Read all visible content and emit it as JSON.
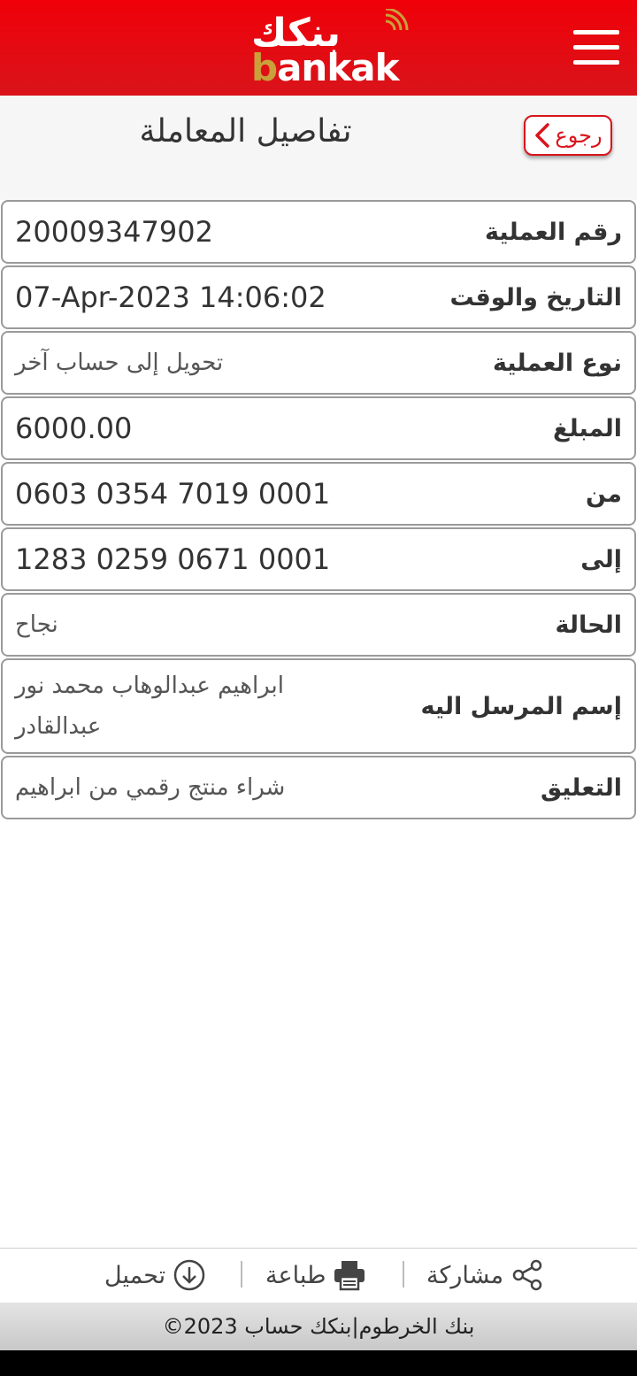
{
  "header": {
    "logo_ar": "بنكك",
    "logo_en_b": "b",
    "logo_en_rest": "ankak",
    "menu_icon": "hamburger-menu-icon",
    "color": "#e5111a"
  },
  "subheader": {
    "back_label": "رجوع",
    "title": "تفاصيل المعاملة"
  },
  "details": [
    {
      "label": "رقم العملية",
      "value": "20009347902"
    },
    {
      "label": "التاريخ والوقت",
      "value": "07-Apr-2023 14:06:02"
    },
    {
      "label": "نوع العملية",
      "value": "تحويل إلى حساب آخر"
    },
    {
      "label": "المبلغ",
      "value": "6000.00"
    },
    {
      "label": "من",
      "value": "0603 0354 7019 0001"
    },
    {
      "label": "إلى",
      "value": "1283 0259 0671 0001"
    },
    {
      "label": "الحالة",
      "value": "نجاح"
    },
    {
      "label": "إسم المرسل اليه",
      "value": "ابراهيم عبدالوهاب محمد نور عبدالقادر"
    },
    {
      "label": "التعليق",
      "value": "شراء منتج رقمي من ابراهيم"
    }
  ],
  "actions": {
    "share_label": "مشاركة",
    "print_label": "طباعة",
    "download_label": "تحميل"
  },
  "footer": {
    "copyright": "©2023 بنك الخرطوم|بنكك حساب"
  }
}
